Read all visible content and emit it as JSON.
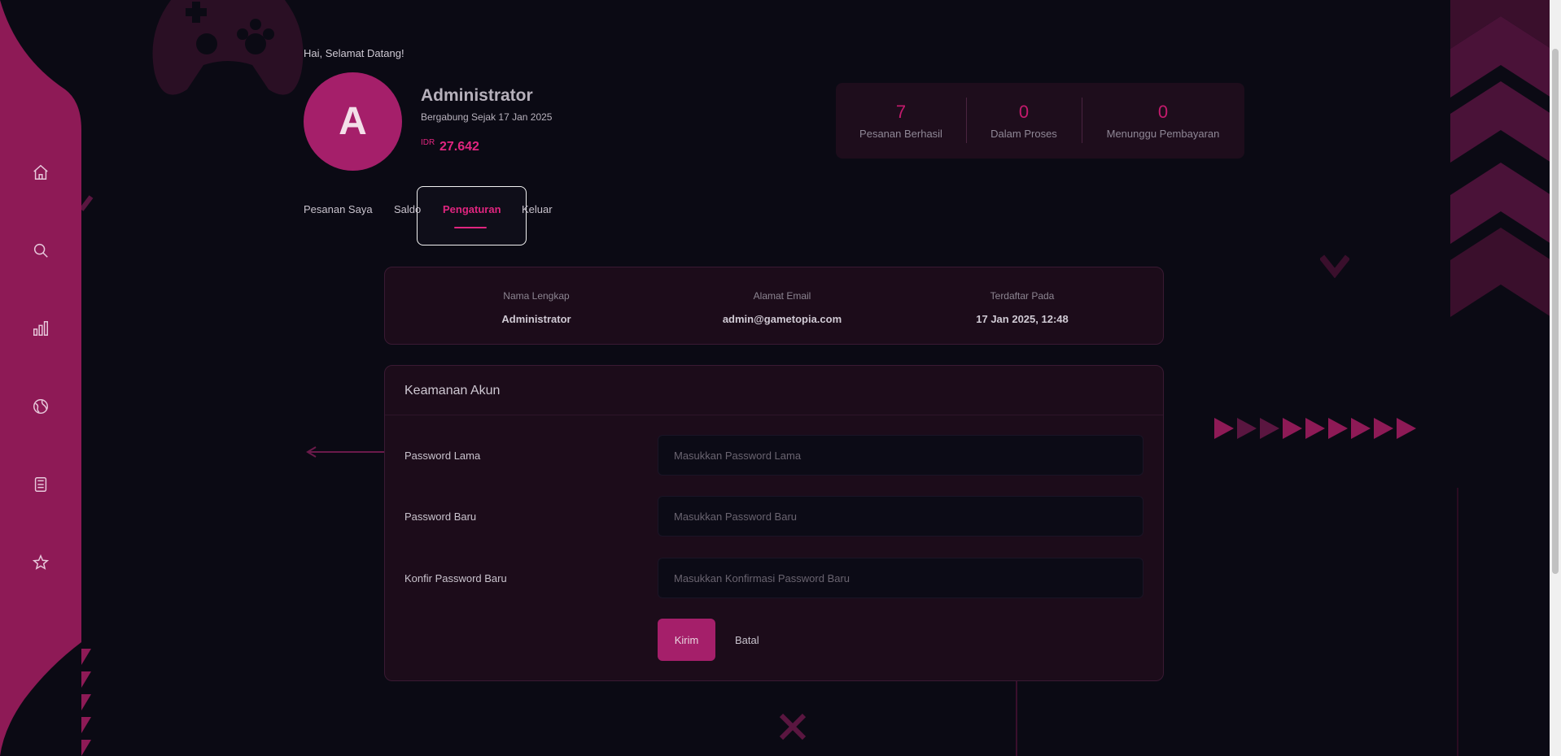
{
  "colors": {
    "accent": "#e0257f",
    "sidebar": "#8e1a56",
    "background": "#0b0a14",
    "card": "#1c0c1a"
  },
  "sidebar": {
    "icons": [
      "home-icon",
      "search-icon",
      "bar-chart-icon",
      "globe-icon",
      "calculator-icon",
      "star-icon"
    ]
  },
  "profile": {
    "greeting": "Hai, Selamat Datang!",
    "avatar_letter": "A",
    "name": "Administrator",
    "joined": "Bergabung Sejak 17 Jan 2025",
    "balance_currency": "IDR",
    "balance_value": "27.642"
  },
  "stats": [
    {
      "value": "7",
      "label": "Pesanan Berhasil"
    },
    {
      "value": "0",
      "label": "Dalam Proses"
    },
    {
      "value": "0",
      "label": "Menunggu Pembayaran"
    }
  ],
  "tabs": [
    {
      "label": "Pesanan Saya",
      "active": false
    },
    {
      "label": "Saldo",
      "active": false
    },
    {
      "label": "Pengaturan",
      "active": true
    },
    {
      "label": "Keluar",
      "active": false
    }
  ],
  "account_info": [
    {
      "label": "Nama Lengkap",
      "value": "Administrator"
    },
    {
      "label": "Alamat Email",
      "value": "admin@gametopia.com"
    },
    {
      "label": "Terdaftar Pada",
      "value": "17 Jan 2025, 12:48"
    }
  ],
  "security": {
    "title": "Keamanan Akun",
    "fields": [
      {
        "label": "Password Lama",
        "placeholder": "Masukkan Password Lama",
        "value": ""
      },
      {
        "label": "Password Baru",
        "placeholder": "Masukkan Password Baru",
        "value": ""
      },
      {
        "label": "Konfir Password Baru",
        "placeholder": "Masukkan Konfirmasi Password Baru",
        "value": ""
      }
    ],
    "submit_label": "Kirim",
    "cancel_label": "Batal"
  }
}
